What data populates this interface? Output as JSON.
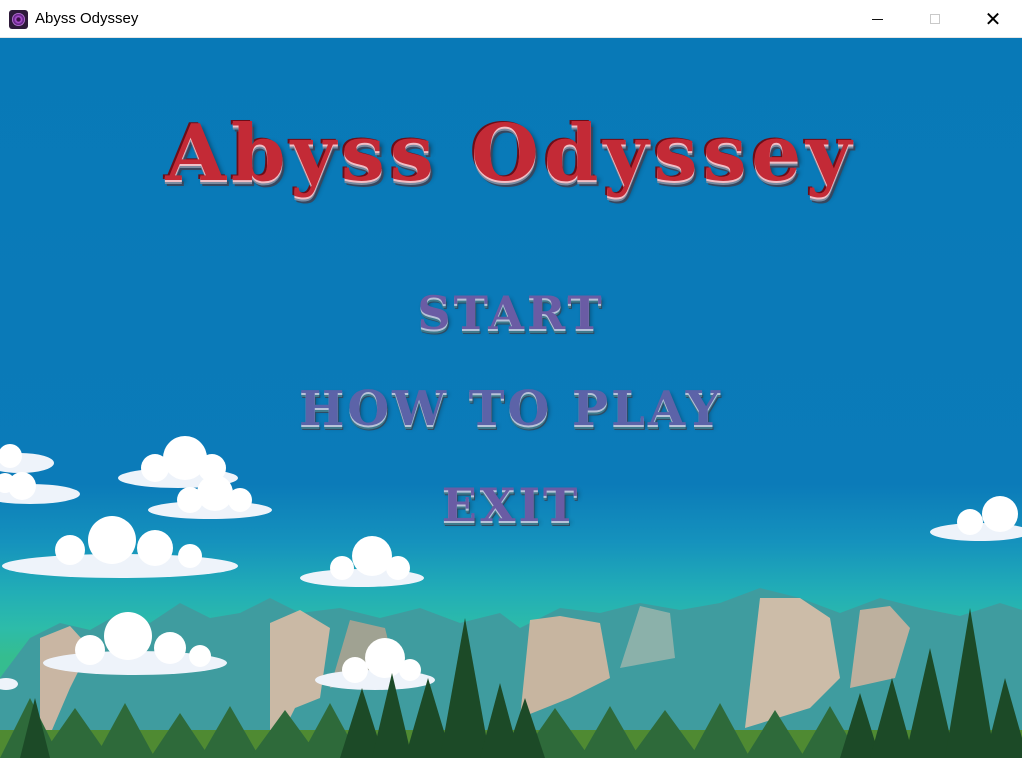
{
  "window": {
    "title": "Abyss Odyssey",
    "icon": "app-orb-icon",
    "controls": {
      "minimize": "minimize-icon",
      "maximize": "maximize-icon",
      "close": "close-icon"
    }
  },
  "game": {
    "title": "Abyss Odyssey",
    "menu": [
      {
        "label": "START"
      },
      {
        "label": "HOW TO PLAY"
      },
      {
        "label": "EXIT"
      }
    ]
  },
  "colors": {
    "sky": "#0879b7",
    "title_red": "#c32a36",
    "menu_purple": "#6a5ca4",
    "mountain": "#3f9c9f",
    "forest": "#1f4d2a"
  }
}
